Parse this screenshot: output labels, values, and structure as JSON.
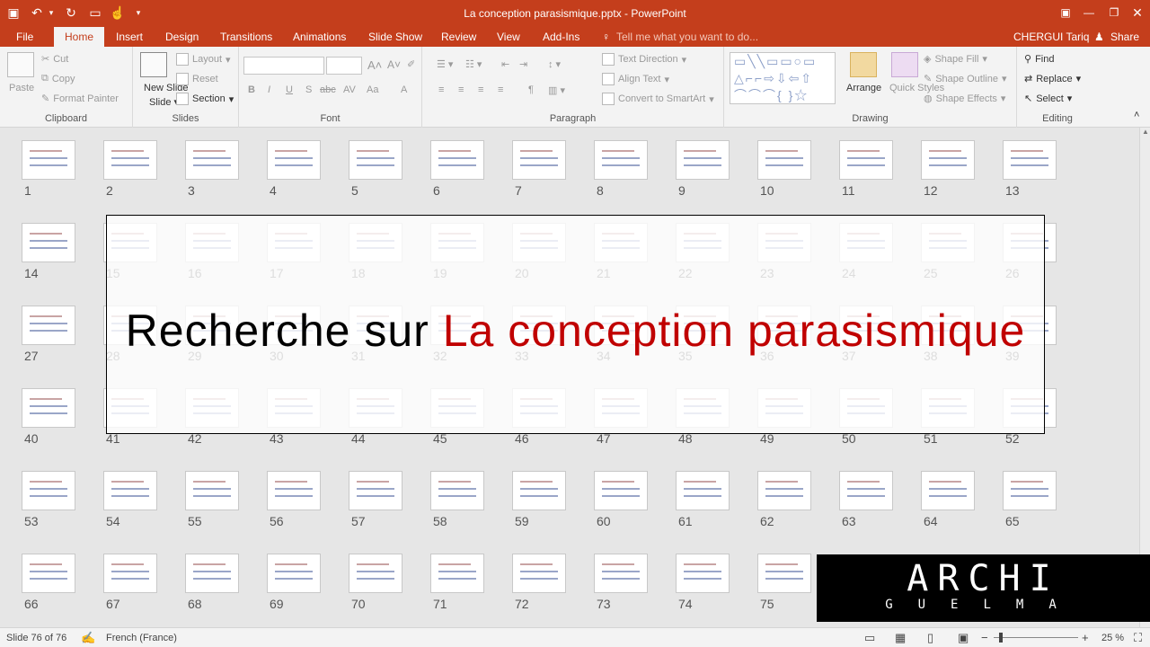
{
  "window": {
    "title": "La conception parasismique.pptx - PowerPoint",
    "user": "CHERGUI Tariq",
    "share": "Share",
    "tell_me": "Tell me what you want to do..."
  },
  "tabs": [
    "File",
    "Home",
    "Insert",
    "Design",
    "Transitions",
    "Animations",
    "Slide Show",
    "Review",
    "View",
    "Add-Ins"
  ],
  "active_tab": "Home",
  "ribbon": {
    "clipboard": {
      "label": "Clipboard",
      "paste": "Paste",
      "cut": "Cut",
      "copy": "Copy",
      "format_painter": "Format Painter"
    },
    "slides": {
      "label": "Slides",
      "new_slide": "New Slide",
      "layout": "Layout",
      "reset": "Reset",
      "section": "Section"
    },
    "font": {
      "label": "Font",
      "bold": "B",
      "italic": "I",
      "underline": "U",
      "shadow": "S",
      "strike": "abc",
      "spacing": "AV",
      "case": "Aa",
      "color": "A"
    },
    "paragraph": {
      "label": "Paragraph",
      "text_direction": "Text Direction",
      "align_text": "Align Text",
      "convert_smartart": "Convert to SmartArt"
    },
    "drawing": {
      "label": "Drawing",
      "arrange": "Arrange",
      "quick_styles": "Quick Styles",
      "shape_fill": "Shape Fill",
      "shape_outline": "Shape Outline",
      "shape_effects": "Shape Effects"
    },
    "editing": {
      "label": "Editing",
      "find": "Find",
      "replace": "Replace",
      "select": "Select"
    }
  },
  "slides": [
    "1",
    "2",
    "3",
    "4",
    "5",
    "6",
    "7",
    "8",
    "9",
    "10",
    "11",
    "12",
    "13",
    "14",
    "15",
    "16",
    "17",
    "18",
    "19",
    "20",
    "21",
    "22",
    "23",
    "24",
    "25",
    "26",
    "27",
    "28",
    "29",
    "30",
    "31",
    "32",
    "33",
    "34",
    "35",
    "36",
    "37",
    "38",
    "39",
    "40",
    "41",
    "42",
    "43",
    "44",
    "45",
    "46",
    "47",
    "48",
    "49",
    "50",
    "51",
    "52",
    "53",
    "54",
    "55",
    "56",
    "57",
    "58",
    "59",
    "60",
    "61",
    "62",
    "63",
    "64",
    "65",
    "66",
    "67",
    "68",
    "69",
    "70",
    "71",
    "72",
    "73",
    "74",
    "75"
  ],
  "overlay": {
    "part1": "Recherche sur ",
    "part2": "La conception parasismique"
  },
  "logo": {
    "big": "ARCHI",
    "small": "GUELMA"
  },
  "status": {
    "slide": "Slide 76 of 76",
    "language": "French (France)",
    "zoom": "25 %"
  },
  "colors": {
    "brand": "#c43e1c",
    "headline_red": "#c00000",
    "headline_black": "#000000"
  }
}
